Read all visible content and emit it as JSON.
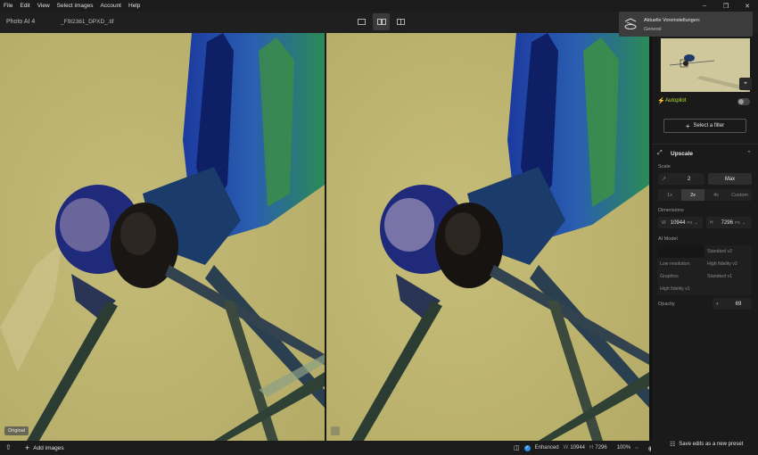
{
  "menu": [
    "File",
    "Edit",
    "View",
    "Select images",
    "Account",
    "Help"
  ],
  "window_controls": [
    "minimize-icon",
    "restore-icon",
    "close-icon"
  ],
  "toolbar": {
    "app_title": "Photo AI  4",
    "file_name": "_F9I2361_DPXD_.tif",
    "view_modes": [
      "single-view-icon",
      "split-view-icon",
      "side-by-side-icon"
    ]
  },
  "panels": {
    "left_tag": "Original"
  },
  "toast": {
    "line1": "Aktuelle Voreinstellungen:",
    "line2": "General"
  },
  "sidebar": {
    "autopilot_label": "Autopilot",
    "filter_button": "Select a filter",
    "upscale_title": "Upscale",
    "scale_label": "Scale",
    "scale_value": "2",
    "max_label": "Max",
    "scale_options": [
      "1x",
      "2x",
      "4x",
      "Custom"
    ],
    "scale_selected": "2x",
    "dimensions_label": "Dimensions",
    "width_prefix": "W",
    "width_value": "10944",
    "width_unit": "PX",
    "height_prefix": "H",
    "height_value": "7296",
    "height_unit": "PX",
    "model_label": "AI Model",
    "models": [
      "Standard v2",
      "Low resolution",
      "High fidelity v2",
      "Graphics",
      "Standard v1",
      "High fidelity v1"
    ],
    "opacity_label": "Opacity",
    "opacity_value": "69",
    "save_preset": "Save edits as a new preset"
  },
  "bottom": {
    "add_images": "Add images",
    "enhanced_label": "Enhanced",
    "w_prefix": "W",
    "w_value": "10944",
    "h_prefix": "H",
    "h_value": "7296",
    "zoom": "100%"
  }
}
